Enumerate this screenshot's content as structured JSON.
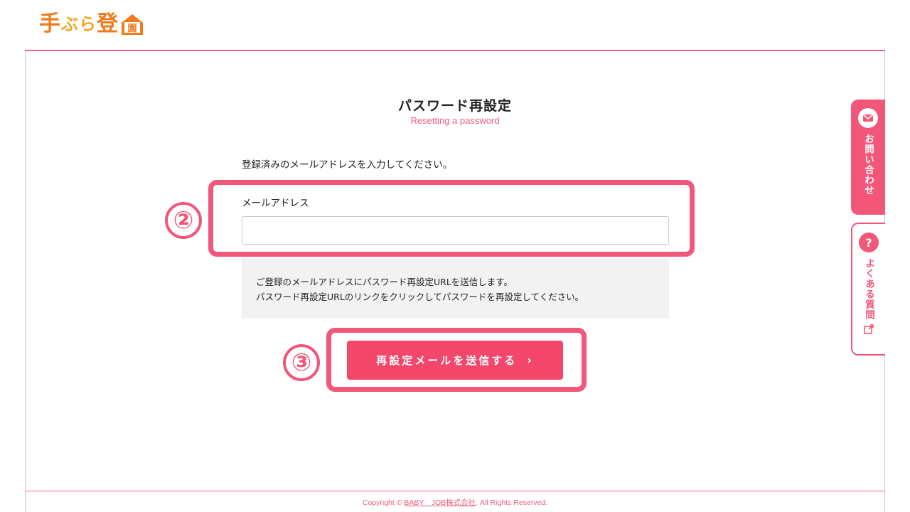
{
  "logo": {
    "part1": "手",
    "part2": "ぶら",
    "part3": "登",
    "part4": "園"
  },
  "page": {
    "title": "パスワード再設定",
    "subtitle": "Resetting a password",
    "instruction": "登録済みのメールアドレスを入力してください。"
  },
  "form": {
    "email_label": "メールアドレス",
    "email_value": "",
    "notice_line1": "ご登録のメールアドレスにパスワード再設定URLを送信します。",
    "notice_line2": "パスワード再設定URLのリンクをクリックしてパスワードを再設定してください。",
    "submit_label": "再設定メールを送信する",
    "submit_chevron": "›"
  },
  "callouts": {
    "num2": "②",
    "num3": "③"
  },
  "side_tabs": {
    "contact_label": "お問い合わせ",
    "contact_icon": "mail-icon",
    "faq_label": "よくある質問",
    "faq_icon": "question-icon"
  },
  "footer": {
    "prefix": "Copyright © ",
    "company": "BABY　JOB株式会社",
    "suffix": ". All Rights Reserved."
  },
  "colors": {
    "accent": "#f2577a",
    "logo_orange": "#f07a1a",
    "logo_yellow": "#f5a623",
    "notice_bg": "#f2f2f2"
  }
}
